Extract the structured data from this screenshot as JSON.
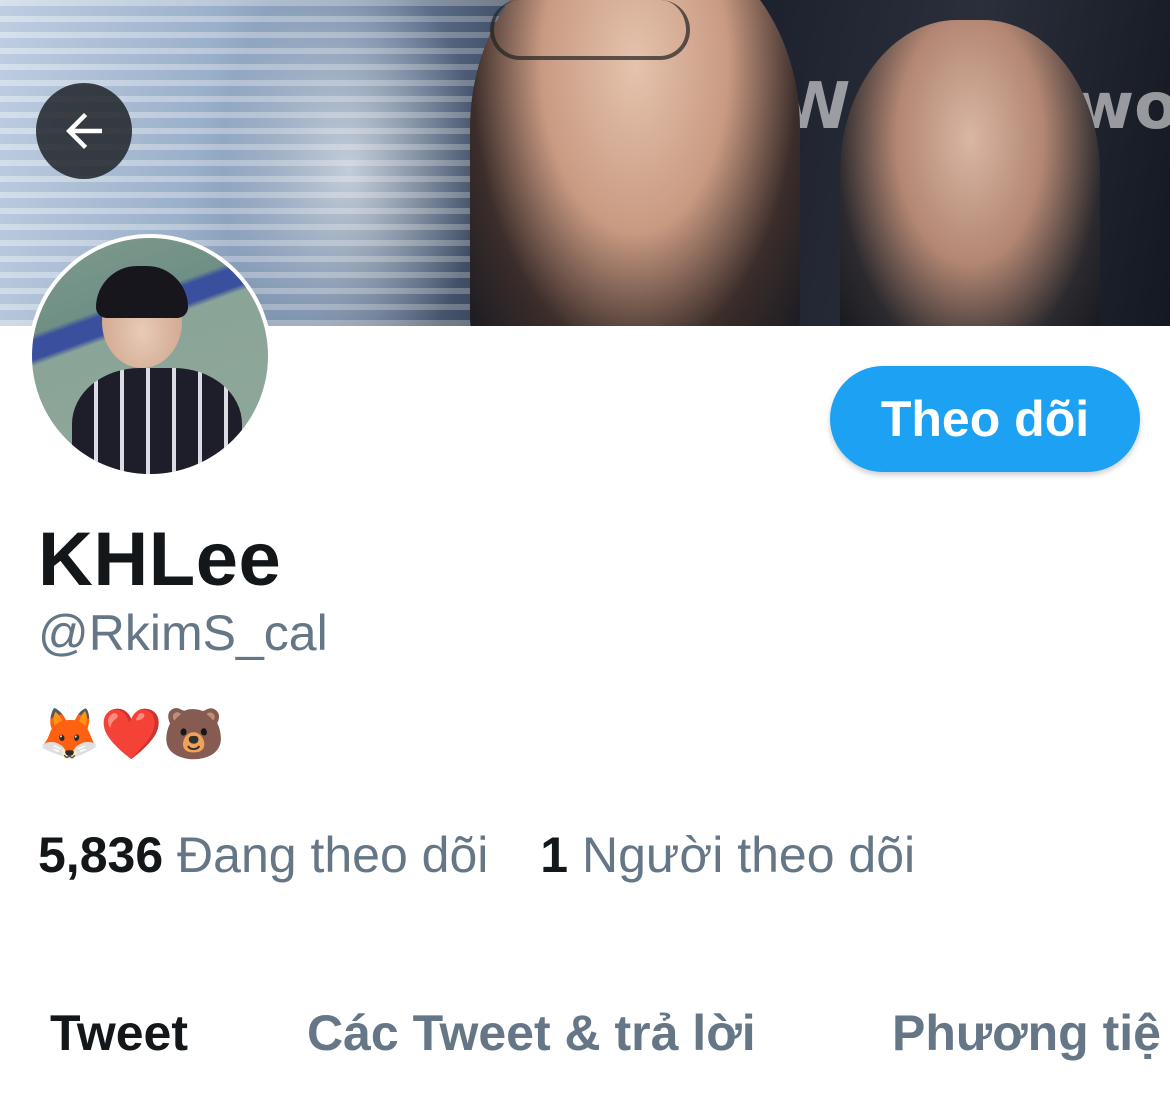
{
  "header": {
    "back_icon": "arrow-left-icon",
    "banner_sign_text": [
      "W",
      "wo"
    ]
  },
  "profile": {
    "follow_label": "Theo dõi",
    "display_name": "KHLee",
    "handle": "@RkimS_cal",
    "bio": "🦊❤️🐻"
  },
  "stats": {
    "following_count": "5,836",
    "following_label": "Đang theo dõi",
    "followers_count": "1",
    "followers_label": "Người theo dõi"
  },
  "tabs": [
    {
      "label": "Tweet",
      "active": true
    },
    {
      "label": "Các Tweet & trả lời",
      "active": false
    },
    {
      "label": "Phương tiệ",
      "active": false
    }
  ],
  "colors": {
    "accent": "#1da1f2",
    "text_primary": "#14171a",
    "text_secondary": "#657786"
  }
}
